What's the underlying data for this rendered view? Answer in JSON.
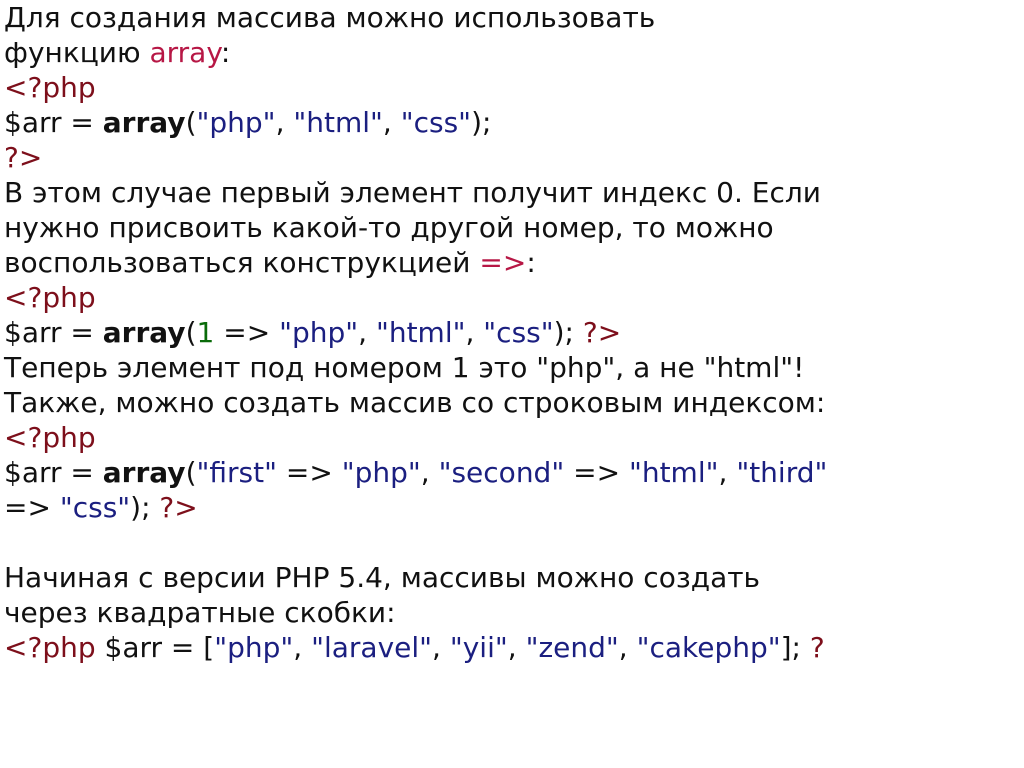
{
  "lines": {
    "l1_a": "Для создания массива можно использовать",
    "l2_a": "функцию ",
    "l2_b": "array",
    "l2_c": ":",
    "l3": "<?php",
    "l4_a": "$arr = ",
    "l4_b": "array",
    "l4_c": "(",
    "l4_d": "\"php\"",
    "l4_e": ", ",
    "l4_f": "\"html\"",
    "l4_g": ", ",
    "l4_h": "\"css\"",
    "l4_i": ");",
    "l5": "?>",
    "l6": "В этом случае первый элемент получит индекс 0. Если",
    "l7": "нужно присвоить какой-то другой номер, то можно",
    "l8_a": "воспользоваться конструкцией ",
    "l8_b": "=>",
    "l8_c": ":",
    "l9": "<?php",
    "l10_a": "$arr = ",
    "l10_b": "array",
    "l10_c": "(",
    "l10_d": "1",
    "l10_e": " => ",
    "l10_f": "\"php\"",
    "l10_g": ", ",
    "l10_h": "\"html\"",
    "l10_i": ", ",
    "l10_j": "\"css\"",
    "l10_k": "); ",
    "l10_l": "?>",
    "l11": "Теперь элемент под номером 1 это \"php\", а не \"html\"!",
    "l12": "Также, можно создать массив со строковым индексом:",
    "l13": "<?php",
    "l14_a": "$arr = ",
    "l14_b": "array",
    "l14_c": "(",
    "l14_d": "\"first\"",
    "l14_e": " => ",
    "l14_f": "\"php\"",
    "l14_g": ", ",
    "l14_h": "\"second\"",
    "l14_i": " => ",
    "l14_j": "\"html\"",
    "l14_k": ", ",
    "l14_l": "\"third\"",
    "l15_a": " => ",
    "l15_b": "\"css\"",
    "l15_c": "); ",
    "l15_d": "?>",
    "l17": "Начиная с версии PHP 5.4, массивы можно создать",
    "l18": "через квадратные скобки:",
    "l19_a": "<?php",
    "l19_b": " $arr = [",
    "l19_c": "\"php\"",
    "l19_d": ", ",
    "l19_e": "\"laravel\"",
    "l19_f": ", ",
    "l19_g": "\"yii\"",
    "l19_h": ", ",
    "l19_i": "\"zend\"",
    "l19_j": ", ",
    "l19_k": "\"cakephp\"",
    "l19_l": "]; ",
    "l19_m": "?"
  }
}
